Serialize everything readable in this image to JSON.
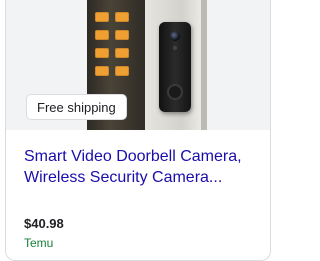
{
  "listing": {
    "badge": "Free shipping",
    "title_line1": "Smart Video Doorbell Camera,",
    "title_line2": "Wireless Security Camera...",
    "price": "$40.98",
    "merchant": "Temu"
  },
  "colors": {
    "title_link": "#1a0dab",
    "merchant": "#188038",
    "price": "#202124"
  },
  "icons": {
    "product_image": "doorbell-product-photo"
  }
}
